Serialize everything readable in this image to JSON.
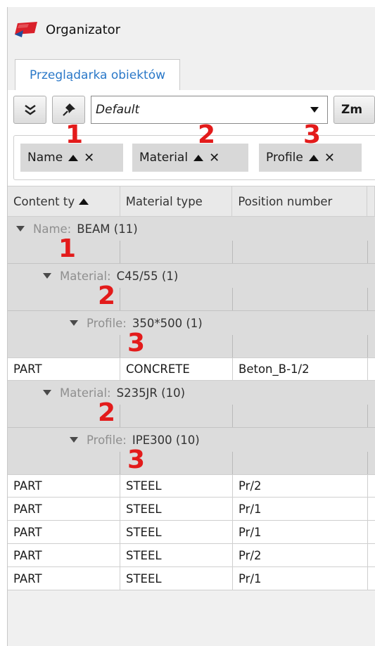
{
  "window": {
    "title": "Organizator"
  },
  "tabs": [
    {
      "label": "Przeglądarka obiektów"
    }
  ],
  "toolbar": {
    "combo_value": "Default",
    "zm_label": "Zm"
  },
  "group_chips": [
    {
      "label": "Name",
      "annotation": "1"
    },
    {
      "label": "Material",
      "annotation": "2"
    },
    {
      "label": "Profile",
      "annotation": "3"
    }
  ],
  "columns": [
    "Content ty",
    "Material type",
    "Position number"
  ],
  "groups": {
    "name": {
      "label": "Name:",
      "value": "BEAM (11)",
      "annotation": "1"
    },
    "material1": {
      "label": "Material:",
      "value": "C45/55 (1)",
      "annotation": "2"
    },
    "profile1": {
      "label": "Profile:",
      "value": "350*500 (1)",
      "annotation": "3"
    },
    "material2": {
      "label": "Material:",
      "value": "S235JR (10)",
      "annotation": "2"
    },
    "profile2": {
      "label": "Profile:",
      "value": "IPE300 (10)",
      "annotation": "3"
    }
  },
  "rows_concrete": [
    [
      "PART",
      "CONCRETE",
      "Beton_B-1/2"
    ]
  ],
  "rows_steel": [
    [
      "PART",
      "STEEL",
      "Pr/2"
    ],
    [
      "PART",
      "STEEL",
      "Pr/1"
    ],
    [
      "PART",
      "STEEL",
      "Pr/1"
    ],
    [
      "PART",
      "STEEL",
      "Pr/2"
    ],
    [
      "PART",
      "STEEL",
      "Pr/1"
    ]
  ],
  "colors": {
    "annotation": "#e31b1b",
    "tab_text": "#2a78c8",
    "group_bg": "#dcdcdc",
    "logo_red": "#d9202a",
    "logo_blue": "#1f4f9c"
  },
  "icons": [
    "app-logo-icon",
    "expand-all-icon",
    "pin-icon",
    "dropdown-arrow-icon",
    "sort-asc-icon",
    "remove-icon",
    "collapse-triangle-icon"
  ]
}
